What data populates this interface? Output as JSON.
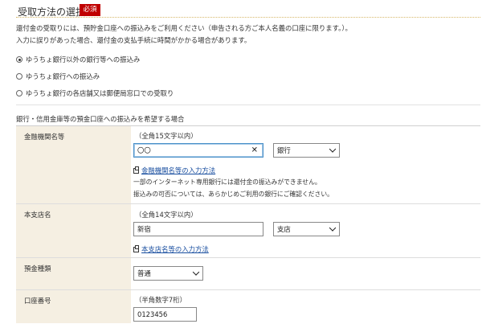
{
  "header": {
    "title": "受取方法の選択",
    "required_badge": "必須"
  },
  "intro": {
    "line1": "還付金の受取りには、預貯金口座への振込みをご利用ください（申告される方ご本人名義の口座に限ります。）。",
    "line2": "入力に誤りがあった場合、還付金の支払手続に時間がかかる場合があります。"
  },
  "receipt_options": [
    {
      "label": "ゆうちょ銀行以外の銀行等への振込み",
      "selected": true
    },
    {
      "label": "ゆうちょ銀行への振込み",
      "selected": false
    },
    {
      "label": "ゆうちょ銀行の各店舗又は郵便局窓口での受取り",
      "selected": false
    }
  ],
  "bank_section": {
    "heading": "銀行・信用金庫等の預金口座への振込みを希望する場合",
    "institution": {
      "label": "金融機関名等",
      "hint": "（全角15文字以内）",
      "value": "〇〇",
      "clear_icon": "close-icon",
      "type_select": "銀行",
      "help_link": "金融機関名等の入力方法",
      "note1": "一部のインターネット専用銀行には還付金の振込みができません。",
      "note2": "振込みの可否については、あらかじめご利用の銀行にご確認ください。"
    },
    "branch": {
      "label": "本支店名",
      "hint": "（全角14文字以内）",
      "value": "新宿",
      "type_select": "支店",
      "help_link": "本支店名等の入力方法"
    },
    "deposit_type": {
      "label": "預金種類",
      "select": "普通"
    },
    "account_number": {
      "label": "口座番号",
      "hint": "（半角数字7桁）",
      "value": "0123456"
    }
  },
  "colors": {
    "badge_red": "#c00000",
    "label_bg": "#f5efe2",
    "link_blue": "#1a4fa0",
    "focus_border": "#4a90c8"
  }
}
